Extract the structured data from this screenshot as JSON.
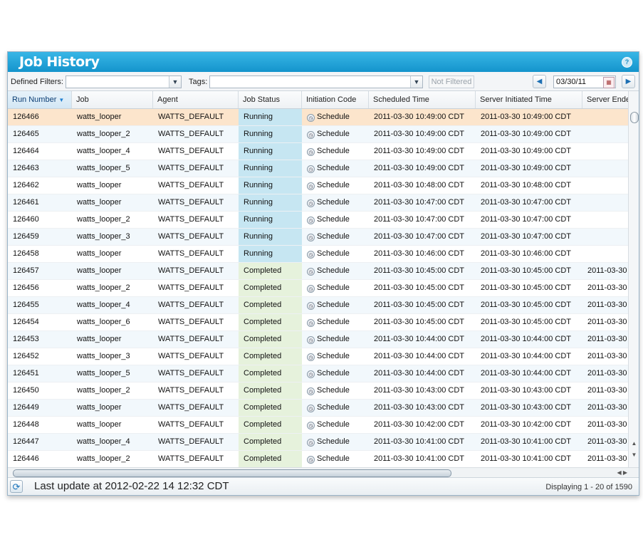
{
  "window": {
    "title": "Job History",
    "help_icon": "?"
  },
  "toolbar": {
    "defined_filters_label": "Defined Filters:",
    "defined_filters_value": "",
    "tags_label": "Tags:",
    "tags_value": "",
    "not_filtered_label": "Not Filtered",
    "date_value": "03/30/11"
  },
  "columns": [
    "Run Number",
    "Job",
    "Agent",
    "Job Status",
    "Initiation Code",
    "Scheduled Time",
    "Server Initiated Time",
    "Server Ended"
  ],
  "rows": [
    {
      "run": "126466",
      "job": "watts_looper",
      "agent": "WATTS_DEFAULT",
      "status": "Running",
      "init": "Schedule",
      "sched": "2011-03-30 10:49:00 CDT",
      "server_init": "2011-03-30 10:49:00 CDT",
      "server_end": ""
    },
    {
      "run": "126465",
      "job": "watts_looper_2",
      "agent": "WATTS_DEFAULT",
      "status": "Running",
      "init": "Schedule",
      "sched": "2011-03-30 10:49:00 CDT",
      "server_init": "2011-03-30 10:49:00 CDT",
      "server_end": ""
    },
    {
      "run": "126464",
      "job": "watts_looper_4",
      "agent": "WATTS_DEFAULT",
      "status": "Running",
      "init": "Schedule",
      "sched": "2011-03-30 10:49:00 CDT",
      "server_init": "2011-03-30 10:49:00 CDT",
      "server_end": ""
    },
    {
      "run": "126463",
      "job": "watts_looper_5",
      "agent": "WATTS_DEFAULT",
      "status": "Running",
      "init": "Schedule",
      "sched": "2011-03-30 10:49:00 CDT",
      "server_init": "2011-03-30 10:49:00 CDT",
      "server_end": ""
    },
    {
      "run": "126462",
      "job": "watts_looper",
      "agent": "WATTS_DEFAULT",
      "status": "Running",
      "init": "Schedule",
      "sched": "2011-03-30 10:48:00 CDT",
      "server_init": "2011-03-30 10:48:00 CDT",
      "server_end": ""
    },
    {
      "run": "126461",
      "job": "watts_looper",
      "agent": "WATTS_DEFAULT",
      "status": "Running",
      "init": "Schedule",
      "sched": "2011-03-30 10:47:00 CDT",
      "server_init": "2011-03-30 10:47:00 CDT",
      "server_end": ""
    },
    {
      "run": "126460",
      "job": "watts_looper_2",
      "agent": "WATTS_DEFAULT",
      "status": "Running",
      "init": "Schedule",
      "sched": "2011-03-30 10:47:00 CDT",
      "server_init": "2011-03-30 10:47:00 CDT",
      "server_end": ""
    },
    {
      "run": "126459",
      "job": "watts_looper_3",
      "agent": "WATTS_DEFAULT",
      "status": "Running",
      "init": "Schedule",
      "sched": "2011-03-30 10:47:00 CDT",
      "server_init": "2011-03-30 10:47:00 CDT",
      "server_end": ""
    },
    {
      "run": "126458",
      "job": "watts_looper",
      "agent": "WATTS_DEFAULT",
      "status": "Running",
      "init": "Schedule",
      "sched": "2011-03-30 10:46:00 CDT",
      "server_init": "2011-03-30 10:46:00 CDT",
      "server_end": ""
    },
    {
      "run": "126457",
      "job": "watts_looper",
      "agent": "WATTS_DEFAULT",
      "status": "Completed",
      "init": "Schedule",
      "sched": "2011-03-30 10:45:00 CDT",
      "server_init": "2011-03-30 10:45:00 CDT",
      "server_end": "2011-03-30"
    },
    {
      "run": "126456",
      "job": "watts_looper_2",
      "agent": "WATTS_DEFAULT",
      "status": "Completed",
      "init": "Schedule",
      "sched": "2011-03-30 10:45:00 CDT",
      "server_init": "2011-03-30 10:45:00 CDT",
      "server_end": "2011-03-30"
    },
    {
      "run": "126455",
      "job": "watts_looper_4",
      "agent": "WATTS_DEFAULT",
      "status": "Completed",
      "init": "Schedule",
      "sched": "2011-03-30 10:45:00 CDT",
      "server_init": "2011-03-30 10:45:00 CDT",
      "server_end": "2011-03-30"
    },
    {
      "run": "126454",
      "job": "watts_looper_6",
      "agent": "WATTS_DEFAULT",
      "status": "Completed",
      "init": "Schedule",
      "sched": "2011-03-30 10:45:00 CDT",
      "server_init": "2011-03-30 10:45:00 CDT",
      "server_end": "2011-03-30"
    },
    {
      "run": "126453",
      "job": "watts_looper",
      "agent": "WATTS_DEFAULT",
      "status": "Completed",
      "init": "Schedule",
      "sched": "2011-03-30 10:44:00 CDT",
      "server_init": "2011-03-30 10:44:00 CDT",
      "server_end": "2011-03-30"
    },
    {
      "run": "126452",
      "job": "watts_looper_3",
      "agent": "WATTS_DEFAULT",
      "status": "Completed",
      "init": "Schedule",
      "sched": "2011-03-30 10:44:00 CDT",
      "server_init": "2011-03-30 10:44:00 CDT",
      "server_end": "2011-03-30"
    },
    {
      "run": "126451",
      "job": "watts_looper_5",
      "agent": "WATTS_DEFAULT",
      "status": "Completed",
      "init": "Schedule",
      "sched": "2011-03-30 10:44:00 CDT",
      "server_init": "2011-03-30 10:44:00 CDT",
      "server_end": "2011-03-30"
    },
    {
      "run": "126450",
      "job": "watts_looper_2",
      "agent": "WATTS_DEFAULT",
      "status": "Completed",
      "init": "Schedule",
      "sched": "2011-03-30 10:43:00 CDT",
      "server_init": "2011-03-30 10:43:00 CDT",
      "server_end": "2011-03-30"
    },
    {
      "run": "126449",
      "job": "watts_looper",
      "agent": "WATTS_DEFAULT",
      "status": "Completed",
      "init": "Schedule",
      "sched": "2011-03-30 10:43:00 CDT",
      "server_init": "2011-03-30 10:43:00 CDT",
      "server_end": "2011-03-30"
    },
    {
      "run": "126448",
      "job": "watts_looper",
      "agent": "WATTS_DEFAULT",
      "status": "Completed",
      "init": "Schedule",
      "sched": "2011-03-30 10:42:00 CDT",
      "server_init": "2011-03-30 10:42:00 CDT",
      "server_end": "2011-03-30"
    },
    {
      "run": "126447",
      "job": "watts_looper_4",
      "agent": "WATTS_DEFAULT",
      "status": "Completed",
      "init": "Schedule",
      "sched": "2011-03-30 10:41:00 CDT",
      "server_init": "2011-03-30 10:41:00 CDT",
      "server_end": "2011-03-30"
    },
    {
      "run": "126446",
      "job": "watts_looper_2",
      "agent": "WATTS_DEFAULT",
      "status": "Completed",
      "init": "Schedule",
      "sched": "2011-03-30 10:41:00 CDT",
      "server_init": "2011-03-30 10:41:00 CDT",
      "server_end": "2011-03-30"
    }
  ],
  "status_bar": {
    "last_update": "Last update at 2012-02-22 14 12:32 CDT",
    "displaying": "Displaying 1 - 20 of 1590"
  },
  "icons": {
    "help": "help-icon",
    "prev": "chevron-left-icon",
    "next": "chevron-right-icon",
    "calendar": "calendar-icon",
    "refresh": "refresh-icon",
    "schedule": "clock-icon",
    "sort": "sort-desc-icon"
  },
  "colors": {
    "title_bar": "#1ea3dc",
    "running": "#c6e6f2",
    "completed": "#e6f2dc",
    "selected_row": "#fce5cc"
  }
}
